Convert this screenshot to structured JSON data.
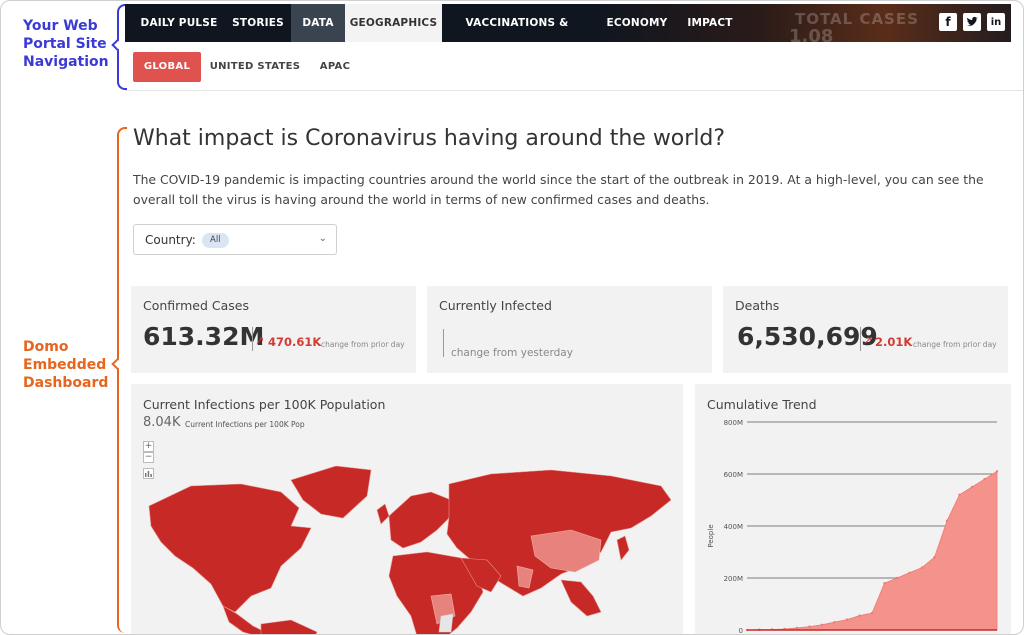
{
  "annotations": {
    "nav_label": [
      "Your Web",
      "Portal Site",
      "Navigation"
    ],
    "domo_label": [
      "Domo",
      "Embedded",
      "Dashboard"
    ]
  },
  "topnav": {
    "tabs": [
      "DAILY PULSE",
      "STORIES",
      "DATA",
      "GEOGRAPHICS",
      "VACCINATIONS & TESTING",
      "ECONOMY",
      "IMPACT"
    ],
    "active": "GEOGRAPHICS",
    "background_text": [
      "TOTAL CASES",
      "1,08"
    ],
    "social_icons": [
      "facebook-icon",
      "twitter-icon",
      "linkedin-icon"
    ]
  },
  "subnav": {
    "tabs": [
      "GLOBAL",
      "UNITED STATES",
      "APAC"
    ],
    "active": "GLOBAL"
  },
  "main": {
    "title": "What impact is Coronavirus having around the world?",
    "description": "The COVID-19 pandemic is impacting countries around the world since the start of the outbreak in 2019. At a high-level, you can see the overall toll the virus is having around the world in terms of new confirmed cases and deaths.",
    "country_filter": {
      "label": "Country:",
      "value": "All"
    }
  },
  "kpis": {
    "confirmed": {
      "title": "Confirmed Cases",
      "value": "613.32M",
      "delta": "470.61K",
      "note": "change from prior day"
    },
    "infected": {
      "title": "Currently Infected",
      "value": "",
      "note": "change from yesterday"
    },
    "deaths": {
      "title": "Deaths",
      "value": "6,530,699",
      "delta": "2.01K",
      "note": "change from prior day"
    }
  },
  "map_panel": {
    "title": "Current Infections per 100K Population",
    "value": "8.04K",
    "value_label": "Current Infections per 100K Pop",
    "controls": [
      "+",
      "−"
    ]
  },
  "colors": {
    "accent": "#e0524e",
    "delta": "#d23a33",
    "nav_bg": "#0f1620",
    "map_red": "#c72a26",
    "area_fill": "#f4928c",
    "nav_annotation": "#3b3ad6",
    "domo_annotation": "#e5661c"
  },
  "chart_data": {
    "type": "area",
    "title": "Cumulative Trend",
    "ylabel": "People",
    "ylim": [
      0,
      800000000
    ],
    "yticks": [
      "0",
      "200M",
      "400M",
      "600M",
      "800M"
    ],
    "x": [
      0,
      0.05,
      0.1,
      0.15,
      0.2,
      0.25,
      0.3,
      0.35,
      0.4,
      0.45,
      0.5,
      0.55,
      0.6,
      0.65,
      0.7,
      0.75,
      0.8,
      0.85,
      0.9,
      0.95,
      1.0
    ],
    "series": [
      {
        "values": [
          0,
          1000000,
          2000000,
          4000000,
          8000000,
          13000000,
          20000000,
          30000000,
          40000000,
          55000000,
          65000000,
          180000000,
          200000000,
          220000000,
          240000000,
          280000000,
          420000000,
          520000000,
          550000000,
          580000000,
          610000000
        ]
      }
    ]
  }
}
